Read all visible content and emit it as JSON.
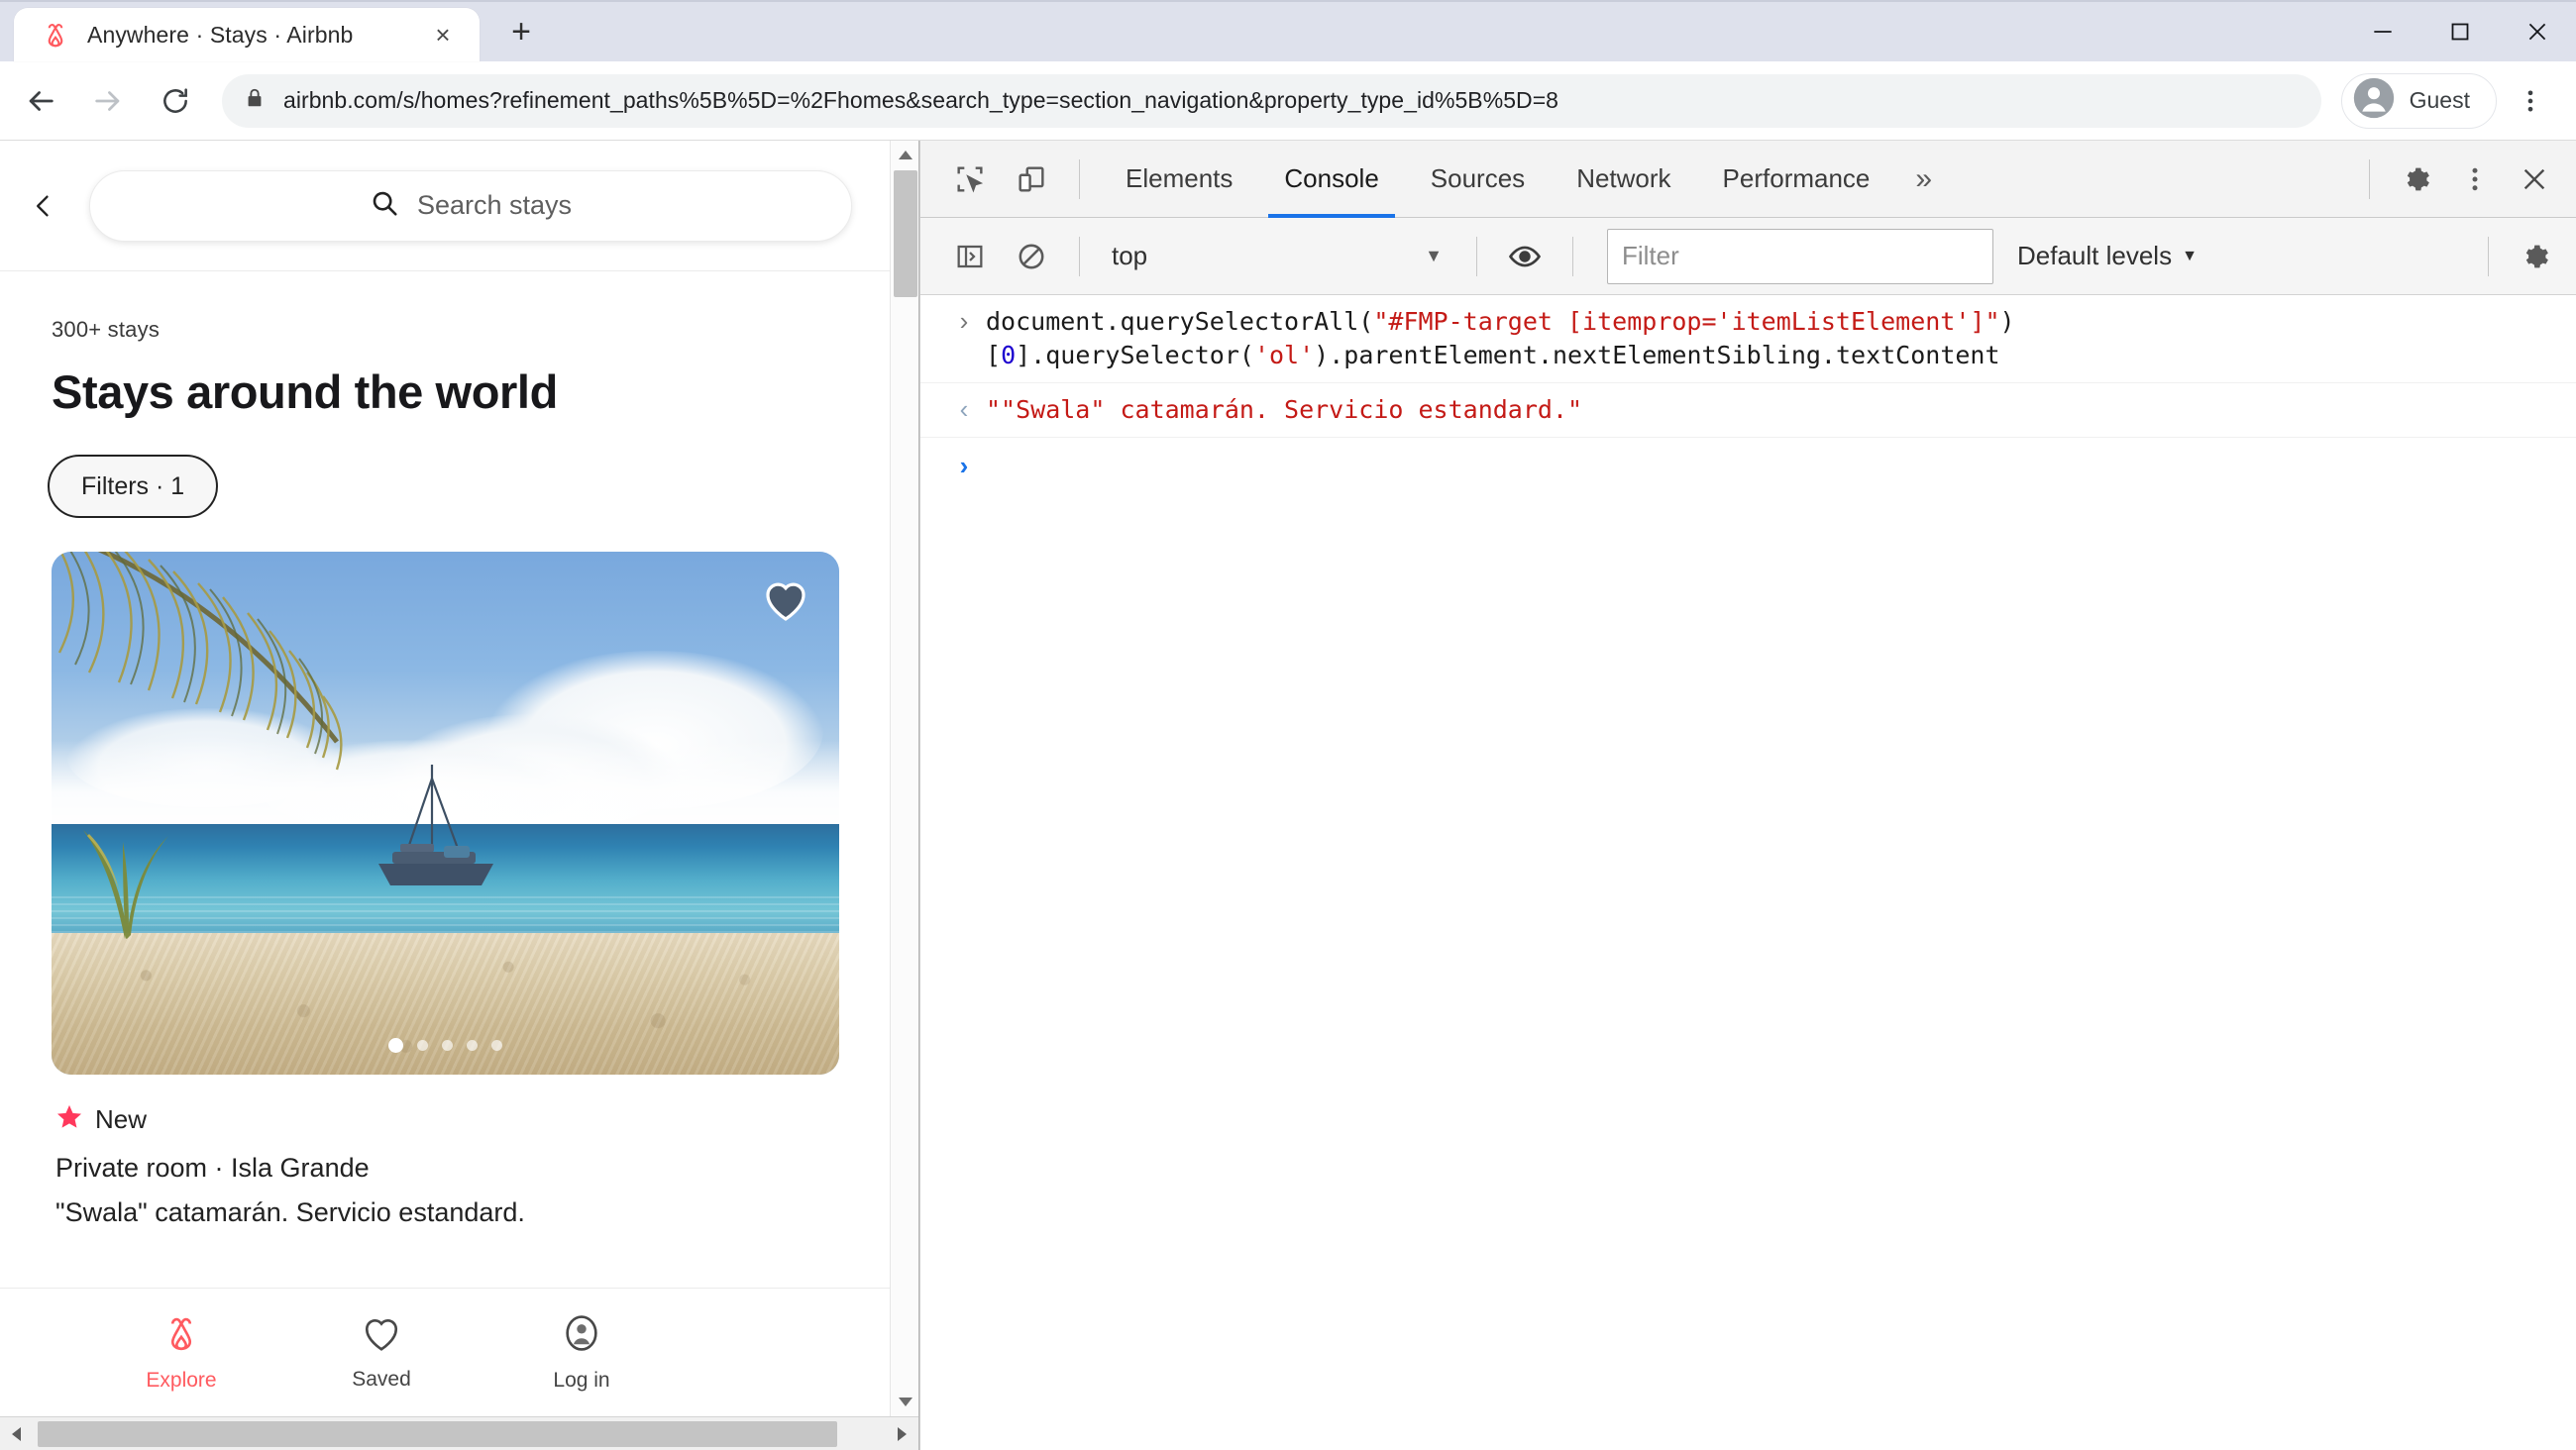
{
  "browser": {
    "tab": {
      "title": "Anywhere · Stays · Airbnb",
      "favicon": "airbnb-logo-icon",
      "close_label": "×"
    },
    "new_tab_label": "+",
    "window_controls": {
      "minimize": "—",
      "maximize": "□",
      "close": "✕"
    },
    "toolbar": {
      "back": "←",
      "forward": "→",
      "reload": "⟳",
      "url": "airbnb.com/s/homes?refinement_paths%5B%5D=%2Fhomes&search_type=section_navigation&property_type_id%5B%5D=8",
      "lock_icon": "lock-icon",
      "profile_name": "Guest",
      "menu": "⋮"
    }
  },
  "page": {
    "header": {
      "back_label": "‹",
      "search_placeholder": "Search stays"
    },
    "stays_count": "300+ stays",
    "title": "Stays around the world",
    "filters_label": "Filters · 1",
    "listing": {
      "rating_badge": "New",
      "star_icon": "star-icon",
      "star_color": "#ff385c",
      "type_and_place": "Private room · Isla Grande",
      "name": "\"Swala\" catamarán. Servicio estandard.",
      "carousel_dots": 5,
      "carousel_active_index": 0,
      "heart_icon": "heart-icon"
    },
    "bottom_nav": [
      {
        "label": "Explore",
        "icon": "airbnb-logo-icon",
        "active": true
      },
      {
        "label": "Saved",
        "icon": "heart-outline-icon",
        "active": false
      },
      {
        "label": "Log in",
        "icon": "user-circle-icon",
        "active": false
      }
    ]
  },
  "devtools": {
    "left_icons": [
      {
        "name": "inspect-element-icon"
      },
      {
        "name": "device-toolbar-icon"
      }
    ],
    "tabs": [
      {
        "label": "Elements",
        "active": false
      },
      {
        "label": "Console",
        "active": true
      },
      {
        "label": "Sources",
        "active": false
      },
      {
        "label": "Network",
        "active": false
      },
      {
        "label": "Performance",
        "active": false
      }
    ],
    "more_tabs_label": "»",
    "settings_icon": "gear-icon",
    "menu_icon": "kebab-icon",
    "close_icon": "close-icon",
    "console_toolbar": {
      "sidebar_toggle_icon": "console-sidebar-icon",
      "clear_icon": "clear-console-icon",
      "context": "top",
      "context_caret": "▼",
      "eye_icon": "live-expression-icon",
      "filter_placeholder": "Filter",
      "levels_label": "Default levels",
      "levels_caret": "▼",
      "settings_icon": "gear-icon"
    },
    "console": {
      "input_marker": "›",
      "output_marker": "‹",
      "prompt_marker": "›",
      "command_parts": [
        {
          "text": "document.querySelectorAll(",
          "kind": "plain"
        },
        {
          "text": "\"#FMP-target [itemprop='itemListElement']\"",
          "kind": "string"
        },
        {
          "text": ")[",
          "kind": "plain"
        },
        {
          "text": "0",
          "kind": "number"
        },
        {
          "text": "].querySelector(",
          "kind": "plain"
        },
        {
          "text": "'ol'",
          "kind": "string"
        },
        {
          "text": ").parentElement.nextElementSibling.textContent",
          "kind": "plain"
        }
      ],
      "result": "\"\"Swala\" catamarán. Servicio estandard.\""
    }
  }
}
